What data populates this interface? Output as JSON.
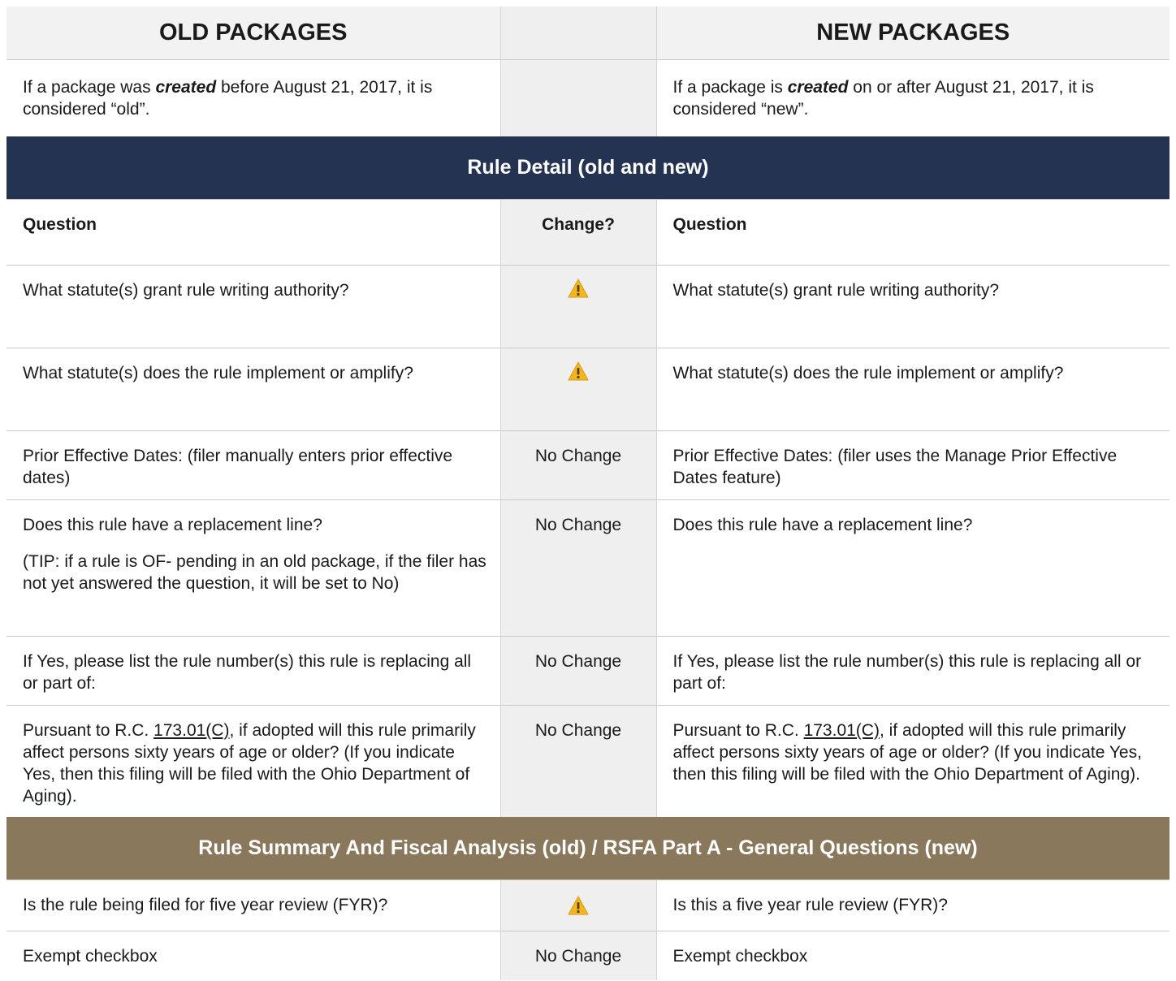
{
  "header": {
    "old_title": "OLD PACKAGES",
    "new_title": "NEW PACKAGES",
    "old_desc_pre": "If a package was ",
    "old_desc_em": "created",
    "old_desc_post": " before August 21, 2017, it is considered “old”.",
    "new_desc_pre": "If a package is ",
    "new_desc_em": "created",
    "new_desc_post": " on or after August 21, 2017, it is considered “new”."
  },
  "section1": {
    "title": "Rule Detail (old and new)",
    "col_old": "Question",
    "col_change": "Change?",
    "col_new": "Question",
    "rows": [
      {
        "old": "What statute(s) grant rule writing authority?",
        "change_icon": "warning-icon",
        "new": "What statute(s) grant rule writing authority?"
      },
      {
        "old": "What statute(s) does the rule implement or amplify?",
        "change_icon": "warning-icon",
        "new": "What statute(s) does the rule implement or amplify?"
      },
      {
        "old": "Prior Effective Dates: (filer manually enters prior effective dates)",
        "change": "No Change",
        "new": "Prior Effective Dates: (filer uses the Manage Prior Effective Dates feature)"
      },
      {
        "old": "Does this rule have a replacement line?",
        "old_tip": "(TIP: if a rule is OF- pending in an old package, if the filer has not yet answered the question, it will be set to No)",
        "change": "No Change",
        "new": "Does this rule have a replacement line?"
      },
      {
        "old": "If Yes, please list the rule number(s) this rule is replacing all or part of:",
        "change": "No Change",
        "new": "If Yes, please list the rule number(s) this rule is replacing all or part of:"
      },
      {
        "old_pre": "Pursuant to R.C. ",
        "old_ref": "173.01(C)",
        "old_post": ", if adopted will this rule primarily affect persons sixty years of age or older? (If you indicate Yes, then this filing will be filed with the Ohio Department of Aging).",
        "change": "No Change",
        "new_pre": "Pursuant to R.C. ",
        "new_ref": "173.01(C)",
        "new_post": ", if adopted will this rule primarily affect persons sixty years of age or older? (If you indicate Yes, then this filing will be filed with the Ohio Department of Aging)."
      }
    ]
  },
  "section2": {
    "title": "Rule Summary And Fiscal Analysis (old) / RSFA Part A - General Questions (new)",
    "rows": [
      {
        "old": "Is the rule being filed for five year review (FYR)?",
        "change_icon": "warning-icon",
        "new": "Is this a five year rule review (FYR)?"
      },
      {
        "old": "Exempt checkbox",
        "change": "No Change",
        "new": "Exempt checkbox"
      }
    ]
  },
  "colors": {
    "navy_band": "#243352",
    "gold_band": "#8a785c",
    "warning": "#f2b71f"
  }
}
